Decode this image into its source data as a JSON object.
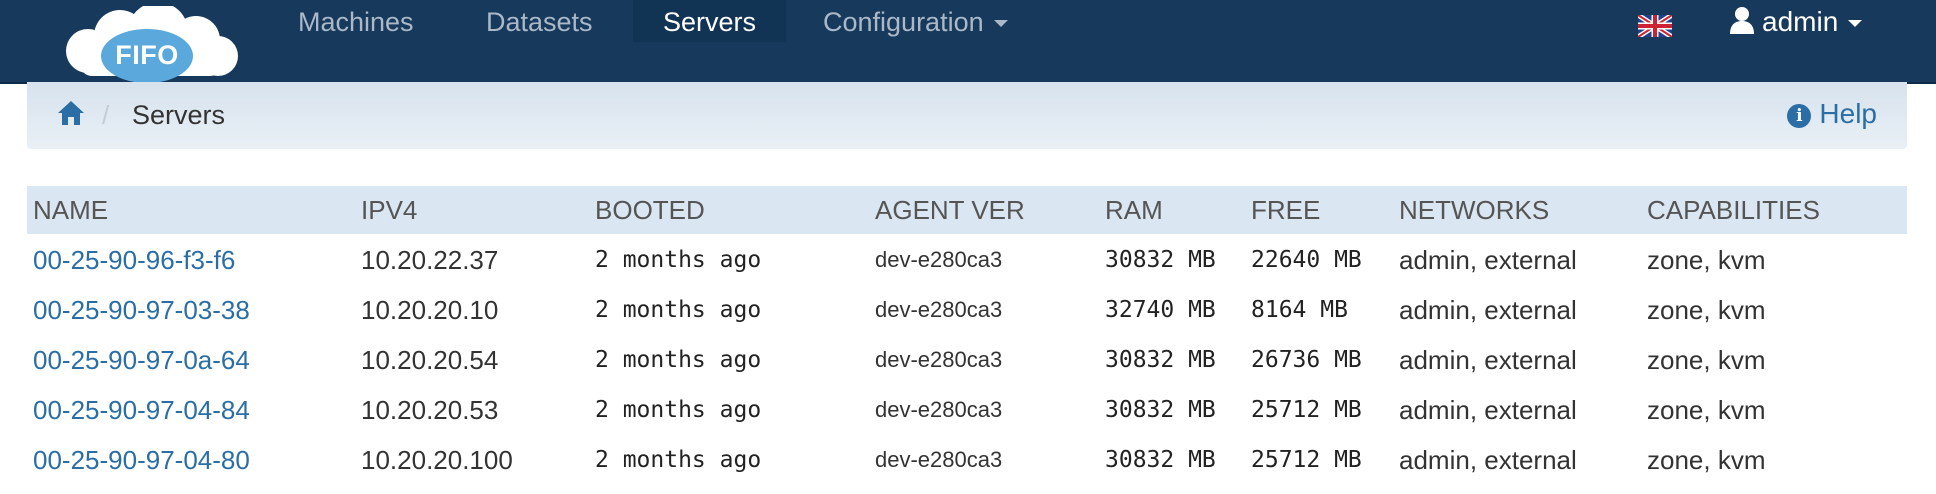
{
  "brand": {
    "logo_text": "FIFO"
  },
  "nav": {
    "items": [
      {
        "label": "Machines"
      },
      {
        "label": "Datasets"
      },
      {
        "label": "Servers",
        "active": true
      },
      {
        "label": "Configuration",
        "dropdown": true
      }
    ],
    "user": {
      "label": "admin",
      "icon": "user-icon"
    },
    "language_flag": "uk-flag-icon"
  },
  "breadcrumb": {
    "home_icon": "home-icon",
    "separator": "/",
    "current": "Servers",
    "help_label": "Help",
    "help_icon": "info-icon"
  },
  "table": {
    "columns": [
      "NAME",
      "IPV4",
      "BOOTED",
      "AGENT VER",
      "RAM",
      "FREE",
      "NETWORKS",
      "CAPABILITIES"
    ],
    "rows": [
      {
        "name": "00-25-90-96-f3-f6",
        "ipv4": "10.20.22.37",
        "booted": "2 months ago",
        "agent": "dev-e280ca3",
        "ram": "30832 MB",
        "free": "22640 MB",
        "networks": "admin, external",
        "capabilities": "zone, kvm"
      },
      {
        "name": "00-25-90-97-03-38",
        "ipv4": "10.20.20.10",
        "booted": "2 months ago",
        "agent": "dev-e280ca3",
        "ram": "32740 MB",
        "free": "8164 MB",
        "networks": "admin, external",
        "capabilities": "zone, kvm"
      },
      {
        "name": "00-25-90-97-0a-64",
        "ipv4": "10.20.20.54",
        "booted": "2 months ago",
        "agent": "dev-e280ca3",
        "ram": "30832 MB",
        "free": "26736 MB",
        "networks": "admin, external",
        "capabilities": "zone, kvm"
      },
      {
        "name": "00-25-90-97-04-84",
        "ipv4": "10.20.20.53",
        "booted": "2 months ago",
        "agent": "dev-e280ca3",
        "ram": "30832 MB",
        "free": "25712 MB",
        "networks": "admin, external",
        "capabilities": "zone, kvm"
      },
      {
        "name": "00-25-90-97-04-80",
        "ipv4": "10.20.20.100",
        "booted": "2 months ago",
        "agent": "dev-e280ca3",
        "ram": "30832 MB",
        "free": "25712 MB",
        "networks": "admin, external",
        "capabilities": "zone, kvm"
      }
    ]
  },
  "colors": {
    "navbar": "#173a5c",
    "nav_active": "#123454",
    "link": "#2a6ea5",
    "table_header": "#dae6f1",
    "logo_cloud": "#ffffff",
    "logo_center": "#5aa8dc"
  }
}
